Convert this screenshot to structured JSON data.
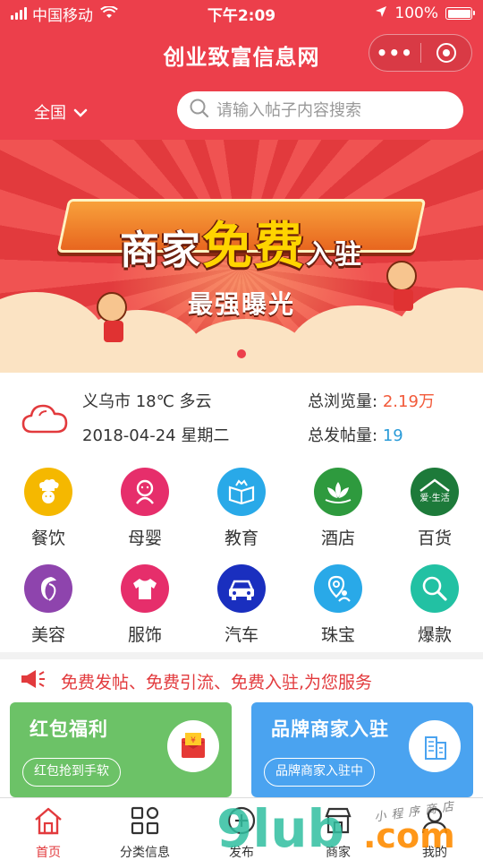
{
  "status_bar": {
    "carrier": "中国移动",
    "time": "下午2:09",
    "battery": "100%"
  },
  "nav": {
    "title": "创业致富信息网",
    "more_label": "•••"
  },
  "search": {
    "region": "全国",
    "placeholder": "请输入帖子内容搜索"
  },
  "banner": {
    "line1_a": "商家",
    "line1_b": "免费",
    "line1_c": "入驻",
    "line2": "最强曝光",
    "slide_index": 1,
    "slide_count": 1
  },
  "info": {
    "weather": "义乌市 18℃ 多云",
    "date": "2018-04-24 星期二",
    "views_label": "总浏览量:",
    "views_value": "2.19万",
    "posts_label": "总发帖量:",
    "posts_value": "19"
  },
  "categories": [
    {
      "label": "餐饮",
      "color": "#f5b800",
      "icon": "chef-icon"
    },
    {
      "label": "母婴",
      "color": "#e62e6b",
      "icon": "baby-icon"
    },
    {
      "label": "教育",
      "color": "#29a9e8",
      "icon": "book-icon"
    },
    {
      "label": "酒店",
      "color": "#2e9a3e",
      "icon": "lotus-icon"
    },
    {
      "label": "百货",
      "color": "#1d7a3a",
      "icon": "house-icon",
      "badge": "爱·生活"
    },
    {
      "label": "美容",
      "color": "#8e44ad",
      "icon": "woman-face-icon"
    },
    {
      "label": "服饰",
      "color": "#e62e6b",
      "icon": "tshirt-icon"
    },
    {
      "label": "汽车",
      "color": "#1a2fbf",
      "icon": "car-icon"
    },
    {
      "label": "珠宝",
      "color": "#29a9e8",
      "icon": "location-person-icon"
    },
    {
      "label": "爆款",
      "color": "#22c1a3",
      "icon": "magnifier-icon"
    }
  ],
  "notice": {
    "text": "免费发帖、免费引流、免费入驻,为您服务"
  },
  "cards": [
    {
      "title": "红包福利",
      "button": "红包抢到手软",
      "color": "#6cc267"
    },
    {
      "title": "品牌商家入驻",
      "button": "品牌商家入驻中",
      "color": "#4aa3f0"
    }
  ],
  "tabs": [
    {
      "label": "首页",
      "icon": "home-icon",
      "active": true
    },
    {
      "label": "分类信息",
      "icon": "grid-icon",
      "active": false
    },
    {
      "label": "发布",
      "icon": "publish-icon",
      "active": false
    },
    {
      "label": "商家",
      "icon": "shop-icon",
      "active": false
    },
    {
      "label": "我的",
      "icon": "user-icon",
      "active": false
    }
  ],
  "watermark": {
    "main": "9lub",
    "suffix": ".com",
    "script": "小程序商店"
  },
  "colors": {
    "brand_red": "#ec3f4b",
    "views_orange": "#f25a3a",
    "posts_blue": "#2a9bd8"
  }
}
